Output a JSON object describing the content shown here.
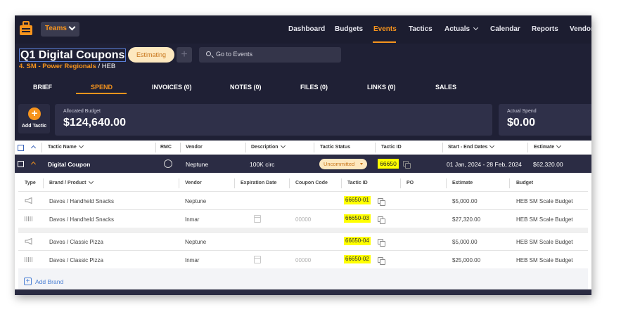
{
  "nav": {
    "teams_label": "Teams",
    "links": [
      {
        "label": "Dashboard"
      },
      {
        "label": "Budgets"
      },
      {
        "label": "Events"
      },
      {
        "label": "Tactics"
      },
      {
        "label": "Actuals"
      },
      {
        "label": "Calendar"
      },
      {
        "label": "Reports"
      },
      {
        "label": "Vendors"
      }
    ],
    "active": "Events",
    "accent_color": "#f7941d"
  },
  "header": {
    "title": "Q1 Digital Coupons",
    "status": "Estimating",
    "add_symbol": "+",
    "search_placeholder": "Go to Events",
    "subline_prefix": "4. SM - Power Regionals",
    "subline_sep": " / ",
    "subline_suffix": "HEB"
  },
  "tabs": [
    {
      "label": "BRIEF"
    },
    {
      "label": "SPEND"
    },
    {
      "label": "INVOICES (0)"
    },
    {
      "label": "NOTES (0)"
    },
    {
      "label": "FILES (0)"
    },
    {
      "label": "LINKS (0)"
    },
    {
      "label": "SALES"
    }
  ],
  "active_tab": "SPEND",
  "add_tactic": {
    "symbol": "+",
    "label": "Add Tactic"
  },
  "allocated": {
    "label": "Allocated Budget",
    "value": "$124,640.00"
  },
  "actual": {
    "label": "Actual Spend",
    "value": "$0.00"
  },
  "tactic_table": {
    "columns": {
      "tactic_name": "Tactic Name",
      "rmc": "RMC",
      "vendor": "Vendor",
      "description": "Description",
      "tactic_status": "Tactic Status",
      "tactic_id": "Tactic ID",
      "dates": "Start - End Dates",
      "estimate": "Estimate"
    },
    "row": {
      "name": "Digital Coupon",
      "vendor": "Neptune",
      "description": "100K circ",
      "status": "Uncommitted",
      "tactic_id": "66650",
      "dates": "01 Jan, 2024 - 28 Feb, 2024",
      "estimate": "$62,320.00"
    }
  },
  "brand_table": {
    "columns": {
      "type": "Type",
      "brand": "Brand / Product",
      "vendor": "Vendor",
      "expiration": "Expiration Date",
      "coupon_code": "Coupon Code",
      "tactic_id": "Tactic ID",
      "po": "PO",
      "estimate": "Estimate",
      "budget": "Budget"
    },
    "rows": [
      {
        "type_icon": "megaphone-icon",
        "brand": "Davos / Handheld Snacks",
        "vendor": "Neptune",
        "coupon": "",
        "tactic_id": "66650-01",
        "estimate": "$5,000.00",
        "budget": "HEB SM Scale Budget"
      },
      {
        "type_icon": "barcode-icon",
        "brand": "Davos / Handheld Snacks",
        "vendor": "Inmar",
        "coupon": "00000",
        "tactic_id": "66650-03",
        "estimate": "$27,320.00",
        "budget": "HEB SM Scale Budget"
      },
      {
        "type_icon": "megaphone-icon",
        "brand": "Davos / Classic Pizza",
        "vendor": "Neptune",
        "coupon": "",
        "tactic_id": "66650-04",
        "estimate": "$5,000.00",
        "budget": "HEB SM Scale Budget"
      },
      {
        "type_icon": "barcode-icon",
        "brand": "Davos / Classic Pizza",
        "vendor": "Inmar",
        "coupon": "00000",
        "tactic_id": "66650-02",
        "estimate": "$25,000.00",
        "budget": "HEB SM Scale Budget"
      }
    ],
    "add_brand_label": "Add Brand",
    "add_brand_symbol": "+",
    "highlight_color": "#ffff00"
  }
}
